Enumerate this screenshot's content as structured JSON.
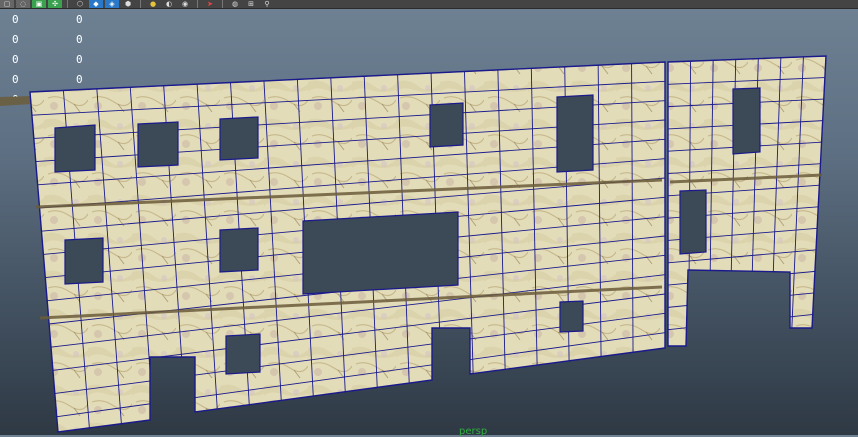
{
  "toolbar": {
    "buttons": [
      {
        "icon": "select-icon",
        "style": "gray"
      },
      {
        "icon": "lasso-icon",
        "style": "gray"
      },
      {
        "icon": "paint-icon",
        "style": "green"
      },
      {
        "icon": "move-icon",
        "style": "green"
      },
      {
        "icon": "sep"
      },
      {
        "icon": "wireframe-icon",
        "style": ""
      },
      {
        "icon": "shaded-icon",
        "style": "blue"
      },
      {
        "icon": "textured-icon",
        "style": "blue"
      },
      {
        "icon": "smooth-icon",
        "style": ""
      },
      {
        "icon": "sep"
      },
      {
        "icon": "light-icon",
        "style": "yellow"
      },
      {
        "icon": "shadow-icon",
        "style": ""
      },
      {
        "icon": "material-icon",
        "style": ""
      },
      {
        "icon": "sep"
      },
      {
        "icon": "pick-icon",
        "style": "red"
      },
      {
        "icon": "sep"
      },
      {
        "icon": "camera-icon",
        "style": ""
      },
      {
        "icon": "grid-icon",
        "style": ""
      },
      {
        "icon": "isolate-icon",
        "style": ""
      }
    ]
  },
  "hud": {
    "rows": [
      {
        "a": "0",
        "b": "0"
      },
      {
        "a": "0",
        "b": "0"
      },
      {
        "a": "0",
        "b": "0"
      },
      {
        "a": "0",
        "b": "0"
      },
      {
        "a": "0",
        "b": "0"
      }
    ]
  },
  "viewport": {
    "camera_name": "persp"
  },
  "colors": {
    "wireframe": "#1a1a8c",
    "stone_light": "#e3dcb8",
    "stone_dark": "#a59468",
    "hole_shadow": "#3c4a58",
    "camera_label": "#2fae3e"
  }
}
